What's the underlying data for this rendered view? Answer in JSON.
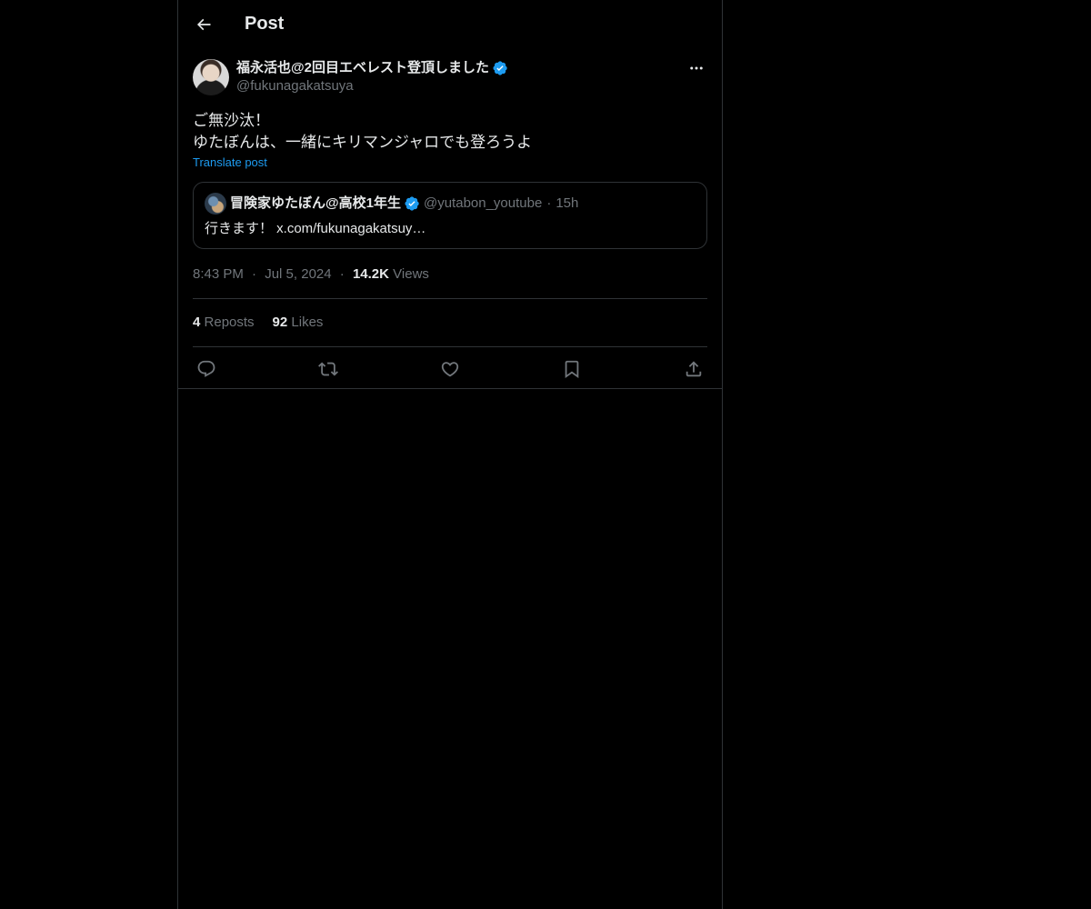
{
  "header": {
    "title": "Post"
  },
  "post": {
    "author_name": "福永活也@2回目エベレスト登頂しました",
    "author_handle": "@fukunagakatsuya",
    "text_line1": "ご無沙汰！",
    "text_line2": "ゆたぼんは、一緒にキリマンジャロでも登ろうよ",
    "translate_label": "Translate post",
    "quote": {
      "name": "冒険家ゆたぼん@高校1年生",
      "handle": "@yutabon_youtube",
      "separator": "·",
      "time": "15h",
      "text": "行きます！ x.com/fukunagakatsuy…"
    },
    "meta": {
      "time": "8:43 PM",
      "separator": "·",
      "date": "Jul 5, 2024",
      "views_count": "14.2K",
      "views_label": "Views"
    },
    "stats": {
      "reposts_count": "4",
      "reposts_label": "Reposts",
      "likes_count": "92",
      "likes_label": "Likes"
    }
  },
  "icons": {
    "back": "arrow-left-icon",
    "more": "more-horizontal-icon",
    "verified": "verified-badge-icon",
    "reply": "reply-icon",
    "repost": "repost-icon",
    "like": "heart-icon",
    "bookmark": "bookmark-icon",
    "share": "share-icon"
  },
  "colors": {
    "background": "#000000",
    "text": "#e7e9ea",
    "secondary": "#71767b",
    "accent": "#1d9bf0",
    "border": "#2f3336"
  }
}
